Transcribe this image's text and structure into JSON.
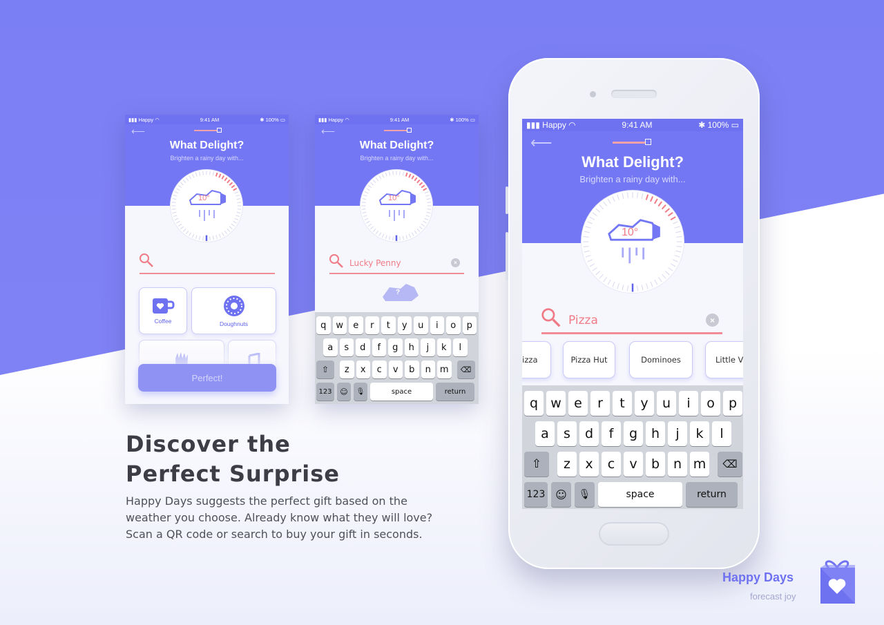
{
  "colors": {
    "primary": "#7477f3",
    "accent": "#f07b86",
    "text": "#3d3d45"
  },
  "status_bar": {
    "carrier": "Happy",
    "time": "9:41 AM",
    "battery": "100%"
  },
  "app": {
    "title": "What Delight?",
    "subtitle": "Brighten a rainy day with...",
    "temperature": "10°"
  },
  "screen1": {
    "categories": [
      {
        "label": "Coffee",
        "icon": "mug-icon"
      },
      {
        "label": "Doughnuts",
        "icon": "doughnut-icon"
      },
      {
        "label": "",
        "icon": "fries-icon"
      },
      {
        "label": "",
        "icon": "music-note-icon"
      }
    ],
    "cta_label": "Perfect!"
  },
  "screen2": {
    "search_value": "Lucky Penny",
    "result_icon_text": "?"
  },
  "screen3": {
    "search_value": "Pizza",
    "suggestions": [
      "Pizza",
      "Pizza Hut",
      "Dominoes",
      "Little V"
    ]
  },
  "keyboard": {
    "row1": [
      "q",
      "w",
      "e",
      "r",
      "t",
      "y",
      "u",
      "i",
      "o",
      "p"
    ],
    "row2": [
      "a",
      "s",
      "d",
      "f",
      "g",
      "h",
      "j",
      "k",
      "l"
    ],
    "row3": [
      "z",
      "x",
      "c",
      "v",
      "b",
      "n",
      "m"
    ],
    "numbers_label": "123",
    "space_label": "space",
    "return_label": "return"
  },
  "marketing": {
    "headline_line1": "Discover the",
    "headline_line2": "Perfect Surprise",
    "body_line1": "Happy Days suggests the perfect gift based on the",
    "body_line2": "weather you choose. Already know what they will love?",
    "body_line3": "Scan a QR code or search to buy your gift in seconds.",
    "brand_name": "Happy Days",
    "brand_tagline": "forecast joy"
  }
}
